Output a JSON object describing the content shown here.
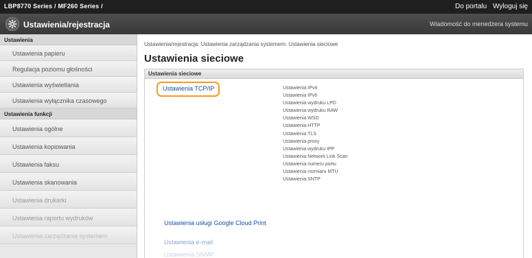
{
  "topbar": {
    "model": "LBP8770 Series / MF260 Series /",
    "links": [
      "Do portalu",
      "Wyloguj się"
    ]
  },
  "appbar": {
    "title": "Ustawienia/rejestracja",
    "message": "Wiadomość do menedżera systemu"
  },
  "sidebar": {
    "section1": "Ustawienia",
    "items1": [
      "Ustawienia papieru",
      "Regulacja poziomu głośności",
      "Ustawienia wyświetlania",
      "Ustawienia wyłącznika czasowego"
    ],
    "section2": "Ustawienia funkcji",
    "items2": [
      "Ustawienia ogólne",
      "Ustawienia kopiowania",
      "Ustawienia faksu",
      "Ustawienia skanowania",
      "Ustawienia drukarki",
      "Ustawienia raportu wydruków",
      "Ustawienia zarządzania systemem"
    ]
  },
  "main": {
    "breadcrumb": "Ustawienia/rejestracja: Ustawienia zarządzania systemem: Ustawienia sieciowe",
    "title": "Ustawienia sieciowe",
    "panel_header": "Ustawienia sieciowe",
    "tcpip_link": "Ustawienia TCP/IP",
    "sub_settings": [
      "Ustawienia IPv4",
      "Ustawienia IPv6",
      "Ustawienia wydruku LPD",
      "Ustawienia wydruku RAW",
      "Ustawienia WSD",
      "Ustawienia HTTP",
      "Ustawienia TLS",
      "Ustawienia proxy",
      "Ustawienia wydruku IPP",
      "Ustawienia Network Link Scan",
      "Ustawienia numeru portu",
      "Ustawienia rozmiaru MTU",
      "Ustawienia SNTP"
    ],
    "google_cloud_link": "Ustawienia usługi Google Cloud Print",
    "email_link": "Ustawienia e-mail",
    "faded_link": "Ustawienia SNMP"
  }
}
